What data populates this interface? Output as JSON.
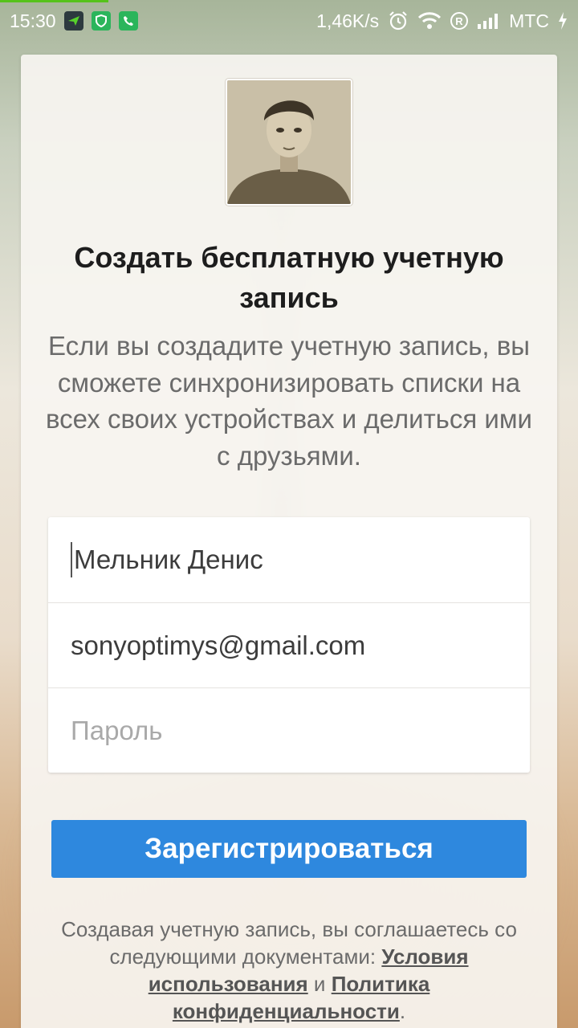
{
  "status_bar": {
    "time": "15:30",
    "speed": "1,46K/s",
    "carrier": "МТС",
    "icons": [
      "app-arrow-icon",
      "shield-icon",
      "phone-icon",
      "alarm-icon",
      "wifi-icon",
      "registered-icon",
      "signal-icon",
      "charging-icon"
    ]
  },
  "signup": {
    "title": "Создать бесплатную учетную запись",
    "subtitle": "Если вы создадите учетную запись, вы сможете синхронизировать списки на всех своих устройствах и делиться ими с друзьями.",
    "name_value": "Мельник Денис",
    "email_value": "sonyoptimys@gmail.com",
    "password_placeholder": "Пароль",
    "submit_label": "Зарегистрироваться",
    "legal_prefix": "Создавая учетную запись, вы соглашаетесь со следующими документами:",
    "terms_link": "Условия использования",
    "and": "и",
    "privacy_link": "Политика конфиденциальности",
    "period": "."
  },
  "colors": {
    "primary": "#2e88de",
    "progress": "#56c21b",
    "title": "#1d1d1d",
    "muted": "#6b6b6b"
  }
}
